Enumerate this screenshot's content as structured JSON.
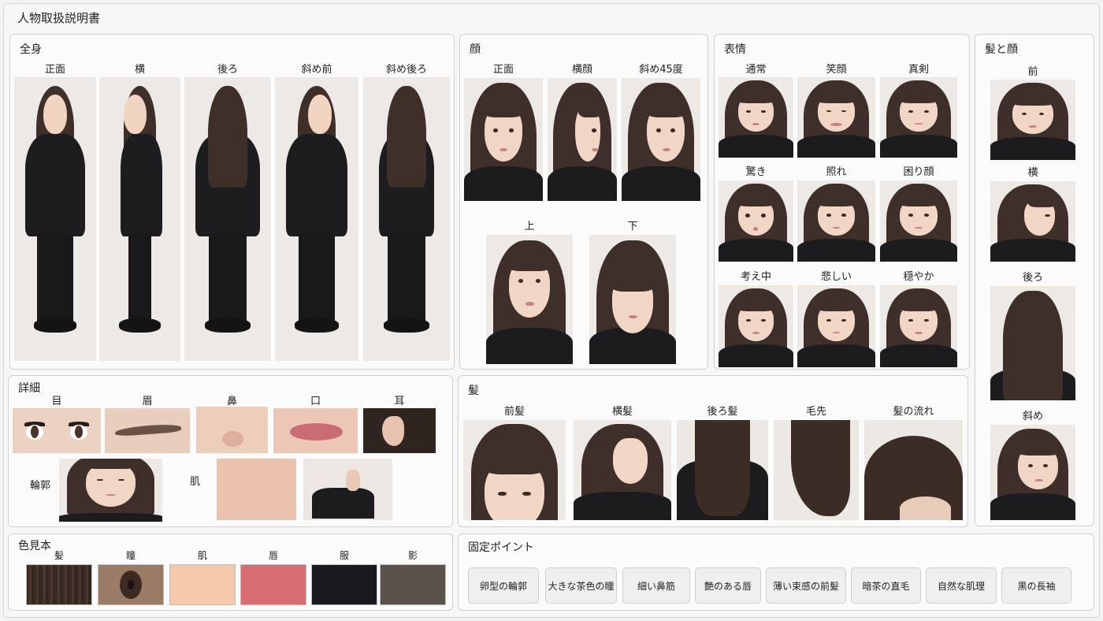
{
  "title": "人物取扱説明書",
  "full_body": {
    "title": "全身",
    "labels": [
      "正面",
      "横",
      "後ろ",
      "斜め前",
      "斜め後ろ"
    ]
  },
  "face": {
    "title": "顔",
    "labels": [
      "正面",
      "横顔",
      "斜め45度",
      "上",
      "下"
    ]
  },
  "expressions": {
    "title": "表情",
    "labels": [
      "通常",
      "笑顔",
      "真剣",
      "驚き",
      "照れ",
      "困り顔",
      "考え中",
      "悲しい",
      "穏やか"
    ]
  },
  "hair_face": {
    "title": "髪と顔",
    "labels": [
      "前",
      "横",
      "後ろ",
      "斜め"
    ]
  },
  "details": {
    "title": "詳細",
    "labels": [
      "目",
      "眉",
      "鼻",
      "口",
      "耳"
    ],
    "contour_label": "輪郭",
    "skin_label": "肌"
  },
  "hair": {
    "title": "髪",
    "labels": [
      "前髪",
      "横髪",
      "後ろ髪",
      "毛先",
      "髪の流れ"
    ]
  },
  "colors": {
    "title": "色見本",
    "swatches": [
      {
        "label": "髪",
        "color": "#3b2c26"
      },
      {
        "label": "瞳",
        "color": "#4a3229"
      },
      {
        "label": "肌",
        "color": "#f5c9ab"
      },
      {
        "label": "唇",
        "color": "#d96d74"
      },
      {
        "label": "服",
        "color": "#1a1a1e"
      },
      {
        "label": "影",
        "color": "#5a524d"
      }
    ]
  },
  "key_points": {
    "title": "固定ポイント",
    "items": [
      "卵型の輪郭",
      "大きな茶色の瞳",
      "細い鼻筋",
      "艶のある唇",
      "薄い束感の前髪",
      "暗茶の直毛",
      "自然な肌理",
      "黒の長袖"
    ]
  }
}
